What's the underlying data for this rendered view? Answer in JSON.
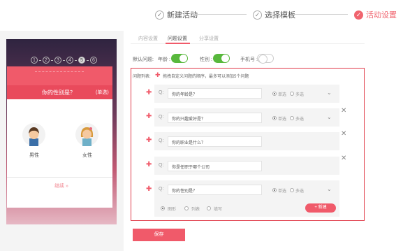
{
  "steps": [
    {
      "label": "新建活动",
      "mark": "✓"
    },
    {
      "label": "选择模板",
      "mark": "✓"
    },
    {
      "label": "活动设置",
      "mark": "✓"
    }
  ],
  "preview": {
    "progress": [
      "1",
      "2",
      "3",
      "4",
      "5",
      "6"
    ],
    "current_step": "5",
    "question": "你的性别是？",
    "question_type": "(单选)",
    "options": [
      "男性",
      "女性"
    ],
    "next": "继续 »"
  },
  "tabs": [
    "内容设置",
    "问题设置",
    "分享设置"
  ],
  "defaults": {
    "label": "默认问题:",
    "items": [
      {
        "label": "年龄 :",
        "on": true
      },
      {
        "label": "性别 :",
        "on": true
      },
      {
        "label": "手机号 :",
        "on": false
      }
    ]
  },
  "list": {
    "label": "问题列表:",
    "hint": "拖拽自定义问题的顺序，最多可以添加5个问题",
    "q_prefix": "Q:",
    "single": "单选",
    "multi": "多选",
    "questions": [
      {
        "text": "你的年龄是？",
        "type": "single"
      },
      {
        "text": "你的兴趣爱好是？",
        "type": "single"
      },
      {
        "text": "你的职业是什么？",
        "type": null
      },
      {
        "text": "你是任职于哪个公司",
        "type": null
      },
      {
        "text": "你的性别是？",
        "type": "single"
      }
    ],
    "answer_types": [
      "图形",
      "列表",
      "填写"
    ],
    "new_button": "+ 新建"
  },
  "save_button": "保存",
  "colors": {
    "accent": "#f05a6a",
    "toggle_on": "#58b83c",
    "box_border": "#e03c4a"
  }
}
